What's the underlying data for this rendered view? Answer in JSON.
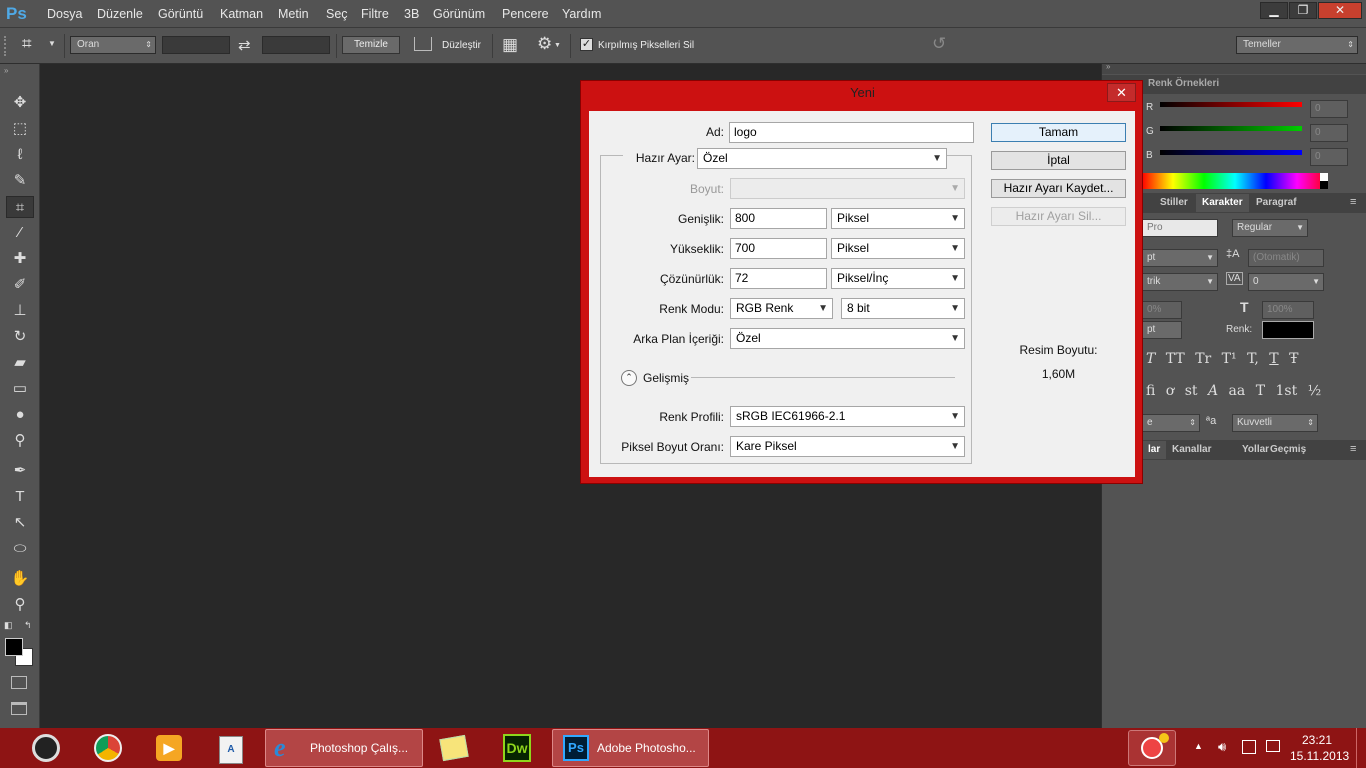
{
  "app": {
    "logo": "Ps"
  },
  "menu": [
    "Dosya",
    "Düzenle",
    "Görüntü",
    "Katman",
    "Metin",
    "Seç",
    "Filtre",
    "3B",
    "Görünüm",
    "Pencere",
    "Yardım"
  ],
  "window_buttons": {
    "minimize": "▁",
    "restore": "❐",
    "close": "✕"
  },
  "options_bar": {
    "ratio_select": "Oran",
    "clear_button": "Temizle",
    "straighten_label": "Düzleştir",
    "delete_cropped_checkbox": "Kırpılmış Pikselleri Sil",
    "delete_cropped_checked": true,
    "workspace_select": "Temeller"
  },
  "right_panel": {
    "swatches_tab": "Renk Örnekleri",
    "color": {
      "r_label": "R",
      "g_label": "G",
      "b_label": "B",
      "r": "0",
      "g": "0",
      "b": "0"
    },
    "tabs2": [
      "Stiller",
      "Karakter",
      "Paragraf"
    ],
    "font_style_partial": "Pro",
    "font_weight": "Regular",
    "size_partial": "pt",
    "leading": "(Otomatik)",
    "kerning_partial": "trik",
    "tracking": "0",
    "vscale": "100%",
    "hscale_partial": "0%",
    "baseline_partial": "pt",
    "color_label": "Renk:",
    "type_buttons": [
      "T",
      "TT",
      "Tr",
      "T¹",
      "T,",
      "T",
      "Ŧ"
    ],
    "otype_buttons": [
      "ﬁ",
      "ơ",
      "st",
      "A",
      "aa",
      "T",
      "1st",
      "½"
    ],
    "lang_partial": "e",
    "aa_label": "ªa",
    "antialias": "Kuvvetli",
    "tabs3": [
      "Kanallar",
      "Yollar",
      "Geçmiş"
    ],
    "tab3_partial": "lar"
  },
  "dialog": {
    "title": "Yeni",
    "close": "✕",
    "name_label": "Ad:",
    "name_value": "logo",
    "preset_label": "Hazır Ayar:",
    "preset_value": "Özel",
    "size_label": "Boyut:",
    "size_value": "",
    "width_label": "Genişlik:",
    "width_value": "800",
    "width_unit": "Piksel",
    "height_label": "Yükseklik:",
    "height_value": "700",
    "height_unit": "Piksel",
    "resolution_label": "Çözünürlük:",
    "resolution_value": "72",
    "resolution_unit": "Piksel/İnç",
    "color_mode_label": "Renk Modu:",
    "color_mode_value": "RGB Renk",
    "bit_depth_value": "8 bit",
    "background_label": "Arka Plan İçeriği:",
    "background_value": "Özel",
    "advanced_label": "Gelişmiş",
    "profile_label": "Renk Profili:",
    "profile_value": "sRGB IEC61966-2.1",
    "aspect_label": "Piksel Boyut Oranı:",
    "aspect_value": "Kare Piksel",
    "ok": "Tamam",
    "cancel": "İptal",
    "save_preset": "Hazır Ayarı Kaydet...",
    "delete_preset": "Hazır Ayarı Sil...",
    "image_size_label": "Resim Boyutu:",
    "image_size_value": "1,60M"
  },
  "taskbar": {
    "tasks": [
      {
        "label": "Photoshop Çalış...",
        "icon": "ie-icon"
      },
      {
        "label": "Adobe Photosho...",
        "icon": "photoshop-icon"
      }
    ],
    "dw_label": "Dw",
    "ps_label": "Ps",
    "time": "23:21",
    "date": "15.11.2013"
  },
  "colors": {
    "dialog_border": "#cc1111",
    "taskbar": "#8e1414",
    "ui_gray": "#535353",
    "canvas": "#282828"
  }
}
